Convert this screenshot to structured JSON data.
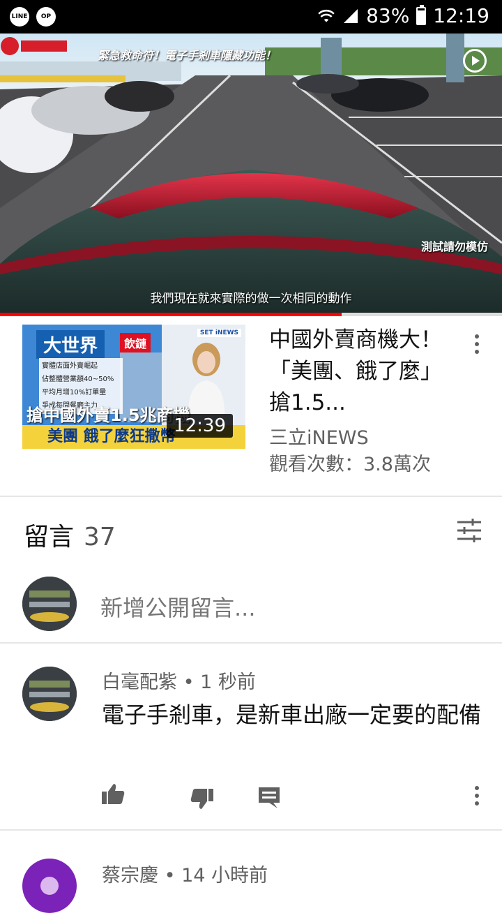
{
  "status_bar": {
    "app_icons": [
      "LINE",
      "OP"
    ],
    "battery_percent": "83%",
    "battery_level": 0.83,
    "time": "12:19",
    "wifi_icon": "wifi-icon",
    "signal_icon": "cell-signal-icon"
  },
  "player": {
    "overlay_title": "緊急救命符！電子手剎車隱藏功能！",
    "warning_text": "測試請勿模仿",
    "subtitle": "我們現在就來實際的做一次相同的動作",
    "progress": 0.68,
    "progress_color": "#ff0000"
  },
  "recommended": {
    "title": "中國外賣商機大！「美團、餓了麼」搶1.5...",
    "channel": "三立iNEWS",
    "views": "觀看次數：3.8萬次",
    "duration": "12:39",
    "thumbnail": {
      "brand": "大世界",
      "tag": "飲鏈",
      "news_badge": "SET iNEWS",
      "bullets": [
        "實體店面外賣崛起",
        "佔整體營業額40~50%",
        "平均月增10%訂單量",
        "爭成每間餐廳主力"
      ],
      "headline": "搶中國外賣1.5兆商機",
      "headline2": "美團 餓了麼狂撒幣"
    }
  },
  "comments": {
    "label": "留言",
    "count": "37",
    "add_placeholder": "新增公開留言...",
    "items": [
      {
        "author": "白毫配紫",
        "time": "1 秒前",
        "text": "電子手剎車，是新車出廠一定要的配備"
      },
      {
        "author": "蔡宗慶",
        "time": "14 小時前",
        "avatar_color": "#7b22b8"
      }
    ]
  },
  "colors": {
    "accent": "#ff0000",
    "secondary_text": "#606060",
    "divider": "#e6e6e6"
  }
}
